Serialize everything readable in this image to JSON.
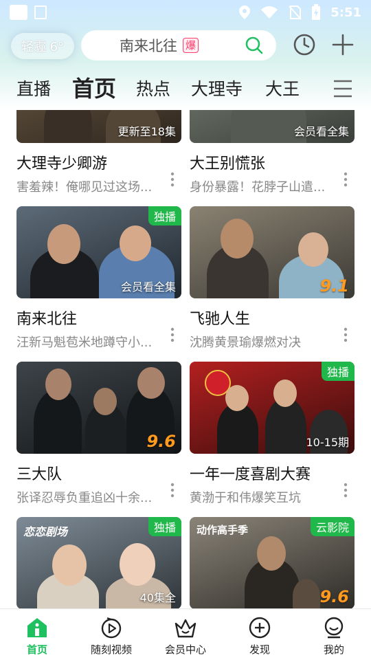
{
  "status_bar": {
    "time": "5:51"
  },
  "header": {
    "weather": "轻霾 6°",
    "search_text": "南来北往",
    "search_badge": "爆"
  },
  "tabs": [
    {
      "label": "直播",
      "active": false
    },
    {
      "label": "首页",
      "active": true
    },
    {
      "label": "热点",
      "active": false
    },
    {
      "label": "大理寺",
      "active": false
    },
    {
      "label": "大王",
      "active": false
    }
  ],
  "feed": [
    {
      "title": "大理寺少卿游",
      "subtitle": "害羞辣！俺哪见过这场...",
      "overlay": "更新至18集",
      "tag": "",
      "score": ""
    },
    {
      "title": "大王别慌张",
      "subtitle": "身份暴露！花脖子山遣...",
      "overlay": "会员看全集",
      "tag": "",
      "score": ""
    },
    {
      "title": "南来北往",
      "subtitle": "汪新马魁苞米地蹲守小...",
      "overlay": "会员看全集",
      "tag": "独播",
      "score": ""
    },
    {
      "title": "飞驰人生",
      "subtitle": "沈腾黄景瑜爆燃对决",
      "overlay": "",
      "tag": "",
      "score": "9.1"
    },
    {
      "title": "三大队",
      "subtitle": "张译忍辱负重追凶十余...",
      "overlay": "",
      "tag": "",
      "score": "9.6"
    },
    {
      "title": "一年一度喜剧大赛",
      "subtitle": "黄渤于和伟爆笑互坑",
      "overlay": "10-15期",
      "tag": "独播",
      "score": ""
    },
    {
      "title": "",
      "subtitle": "",
      "overlay": "40集全",
      "tag": "独播",
      "score": "",
      "logo": "恋恋剧场"
    },
    {
      "title": "",
      "subtitle": "",
      "overlay": "",
      "tag": "云影院",
      "score": "9.6",
      "logo": "动作高手季"
    }
  ],
  "bottom_nav": [
    {
      "label": "首页",
      "icon": "home-icon",
      "active": true
    },
    {
      "label": "随刻视频",
      "icon": "play-circle-icon",
      "active": false
    },
    {
      "label": "会员中心",
      "icon": "crown-icon",
      "active": false
    },
    {
      "label": "发现",
      "icon": "discover-plus-icon",
      "active": false
    },
    {
      "label": "我的",
      "icon": "profile-icon",
      "active": false
    }
  ],
  "colors": {
    "accent": "#1fc060",
    "score": "#ff9a1f",
    "hot_badge": "#ff3b6b",
    "tag_green": "#20b84a"
  }
}
